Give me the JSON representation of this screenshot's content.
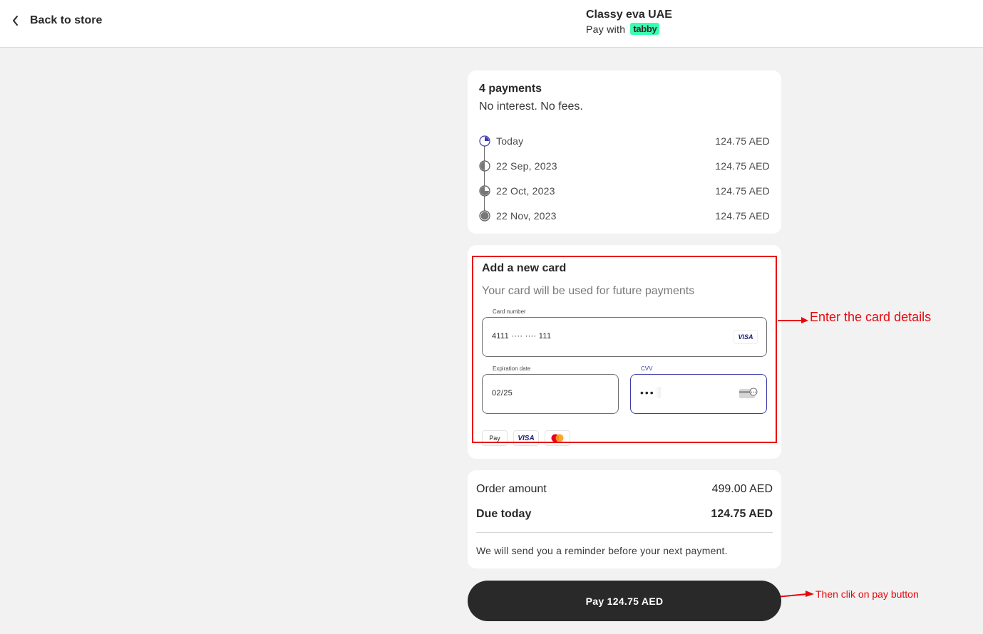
{
  "header": {
    "back_label": "Back to store",
    "merchant_name": "Classy eva UAE",
    "pay_with": "Pay with",
    "brand": "tabby"
  },
  "plan": {
    "title": "4 payments",
    "subtitle": "No interest. No fees.",
    "installments": [
      {
        "date": "Today",
        "amount": "124.75 AED"
      },
      {
        "date": "22 Sep, 2023",
        "amount": "124.75 AED"
      },
      {
        "date": "22 Oct, 2023",
        "amount": "124.75 AED"
      },
      {
        "date": "22 Nov, 2023",
        "amount": "124.75 AED"
      }
    ]
  },
  "new_card": {
    "title": "Add a new card",
    "subtitle": "Your card will be used for future payments",
    "card_number_label": "Card number",
    "card_number_value": "4111 ···· ···· 111",
    "card_brand": "VISA",
    "expiry_label": "Expiration date",
    "expiry_value": "02/25",
    "cvv_label": "CVV",
    "cvv_value": "•••",
    "accepted": [
      "Pay",
      "VISA",
      "mastercard"
    ]
  },
  "summary": {
    "order_label": "Order amount",
    "order_value": "499.00 AED",
    "due_label": "Due today",
    "due_value": "124.75 AED",
    "reminder": "We will send you a reminder before your next payment."
  },
  "pay_button": "Pay 124.75 AED",
  "annotations": {
    "card_details": "Enter the card details",
    "pay": "Then clik on pay button"
  },
  "colors": {
    "accent": "#3bffb0",
    "annotation": "#e8070c",
    "button": "#292929",
    "focus": "#3c3ca8"
  }
}
